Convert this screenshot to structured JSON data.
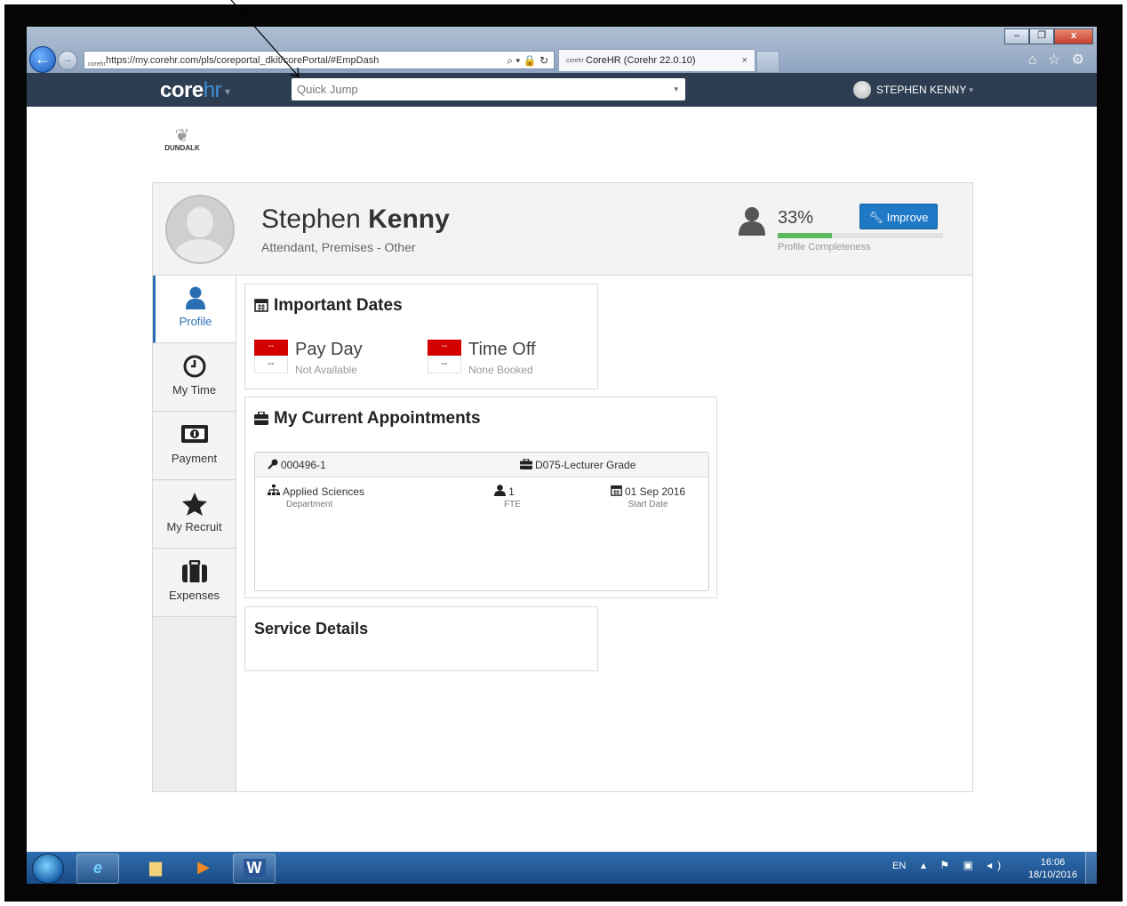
{
  "browser": {
    "url": "https://my.corehr.com/pls/coreportal_dkit/corePortal/#EmpDash",
    "tab_title": "CoreHR (Corehr 22.0.10)",
    "favicon_text": "corehr",
    "tab_close": "×",
    "back_symbol": "←",
    "forward_symbol": "→",
    "address_tools": "⌕ ▾ 🔒 ↻",
    "ie_icons": "⌂ ☆ ⚙",
    "window_buttons": {
      "minimize": "–",
      "restore": "❐",
      "close": "x"
    }
  },
  "appbar": {
    "logo_core": "core",
    "logo_hr": "hr",
    "logo_caret": "▾",
    "quick_jump_placeholder": "Quick Jump",
    "quick_jump_caret": "▾",
    "user_name": "STEPHEN KENNY",
    "user_caret": "▾"
  },
  "org_logo": {
    "mark": "❦",
    "text": "DUNDALK"
  },
  "profile": {
    "first_name": "Stephen",
    "last_name": "Kenny",
    "job_title": "Attendant, Premises - Other",
    "completeness_pct_text": "33%",
    "completeness_value": 0.33,
    "completeness_label": "Profile Completeness",
    "improve_label": "Improve",
    "completeness_color": "#5cb85c"
  },
  "sidebar": {
    "items": [
      {
        "label": "Profile",
        "icon": "user-icon",
        "active": true
      },
      {
        "label": "My Time",
        "icon": "clock-icon"
      },
      {
        "label": "Payment",
        "icon": "money-icon"
      },
      {
        "label": "My Recruit",
        "icon": "star-icon"
      },
      {
        "label": "Expenses",
        "icon": "suitcase-icon"
      }
    ]
  },
  "important_dates": {
    "title": "Important Dates",
    "pay_day": {
      "badge": "--",
      "value": "--",
      "title": "Pay Day",
      "sub": "Not Available"
    },
    "time_off": {
      "badge": "--",
      "value": "--",
      "title": "Time Off",
      "sub": "None Booked"
    }
  },
  "appointments": {
    "title": "My Current Appointments",
    "items": [
      {
        "id": "000496-1",
        "grade": "D075-Lecturer Grade",
        "department": "Applied Sciences",
        "department_label": "Department",
        "fte": "1",
        "fte_label": "FTE",
        "start_date": "01 Sep 2016",
        "start_date_label": "Start Date"
      }
    ]
  },
  "service_details": {
    "title": "Service Details"
  },
  "taskbar": {
    "language": "EN",
    "tray_icons": "▴ ⚑ ▣ ◂)",
    "time": "16:06",
    "date": "18/10/2016",
    "word_label": "W"
  },
  "colors": {
    "appbar": "#2e3e52",
    "accent": "#1f79c6",
    "red": "#d40000"
  }
}
